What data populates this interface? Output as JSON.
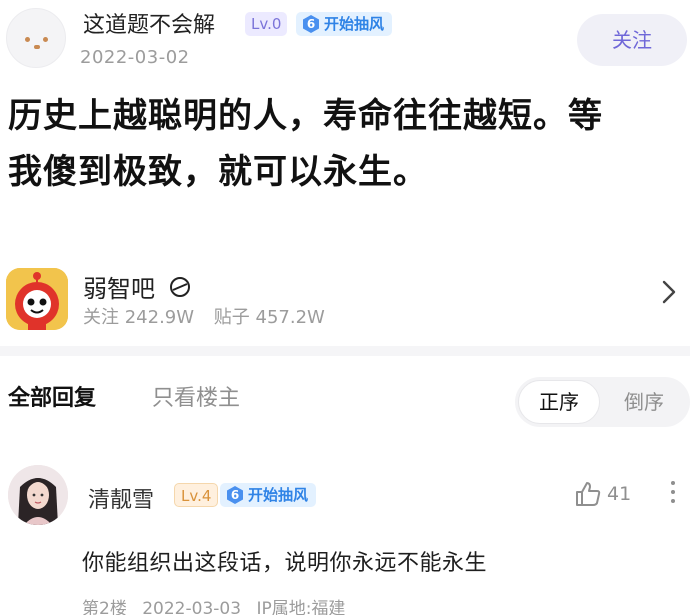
{
  "post": {
    "author_name": "这道题不会解",
    "author_level": "Lv.0",
    "gift_level": "6",
    "gift_label": "开始抽风",
    "date": "2022-03-02",
    "follow_label": "关注",
    "content_line1": "历史上越聪明的人，寿命往往越短。等",
    "content_line2": "我傻到极致，就可以永生。"
  },
  "forum": {
    "name": "弱智吧",
    "follow_stat": "关注 242.9W",
    "post_stat": "贴子 457.2W"
  },
  "reply_tabs": {
    "all": "全部回复",
    "op_only": "只看楼主",
    "sort_asc": "正序",
    "sort_desc": "倒序"
  },
  "reply": {
    "author_name": "清靓雪",
    "author_level": "Lv.4",
    "gift_level": "6",
    "gift_label": "开始抽风",
    "like_count": "41",
    "content": "你能组织出这段话，说明你永远不能永生",
    "floor": "第2楼",
    "date": "2022-03-03",
    "ip": "IP属地:福建"
  },
  "colors": {
    "accent": "#6f67d8",
    "gift_blue": "#2f83e6",
    "level_purple": "#7b74d9",
    "level_orange": "#d9923a"
  },
  "icons": [
    "avatar",
    "gift-hex-icon",
    "chevron-right-icon",
    "thumbs-up-icon",
    "more-vertical-icon",
    "verified-icon"
  ]
}
